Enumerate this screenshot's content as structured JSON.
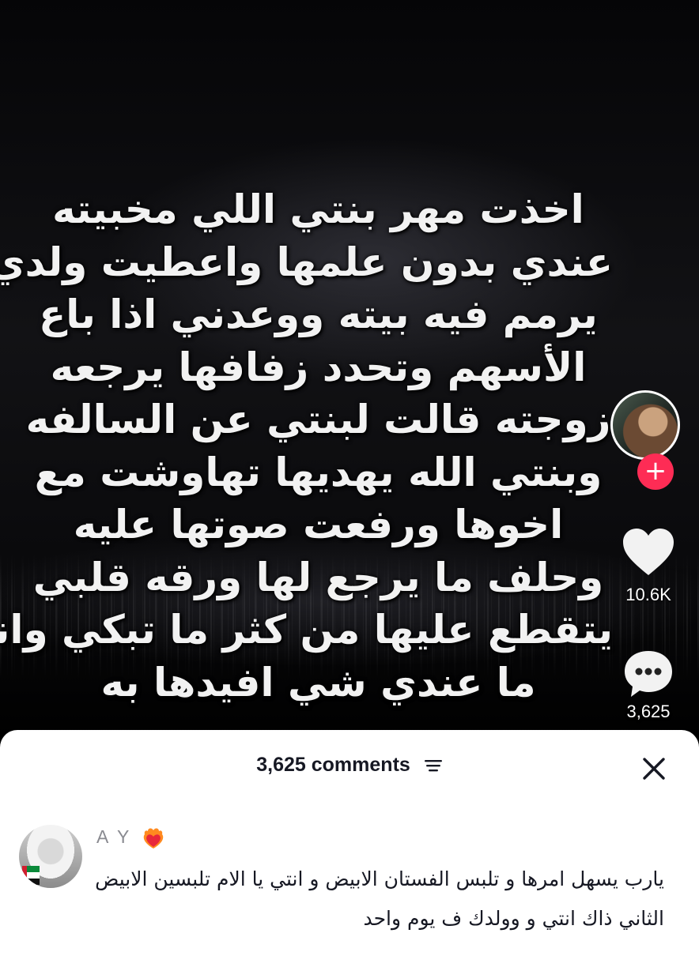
{
  "video": {
    "overlay_lines": [
      "اخذت مهر بنتي اللي مخبيته",
      "عندي بدون علمها واعطيت ولدي",
      "يرمم فيه بيته ووعدني اذا باع",
      "الأسهم وتحدد زفافها يرجعه",
      "زوجته قالت لبنتي عن السالفه",
      "وبنتي الله يهديها تهاوشت مع",
      "اخوها ورفعت صوتها عليه",
      "وحلف ما يرجع لها ورقه قلبي",
      "يتقطع عليها من كثر ما تبكي وانا",
      "ما عندي شي افيدها به"
    ]
  },
  "actions": {
    "follow_label": "+",
    "likes": "10.6K",
    "comments": "3,625",
    "accent_color": "#fe2c55"
  },
  "sheet": {
    "title": "3,625 comments",
    "filter_icon": "filter-lines-icon",
    "close_icon": "close-icon"
  },
  "comment": {
    "username": "A Y",
    "badge_icon": "heart-on-fire-emoji",
    "text": "يارب يسهل امرها و تلبس الفستان الابيض و انتي يا الام تلبسين الابيض الثاني ذاك انتي و وولدك ف يوم واحد"
  }
}
